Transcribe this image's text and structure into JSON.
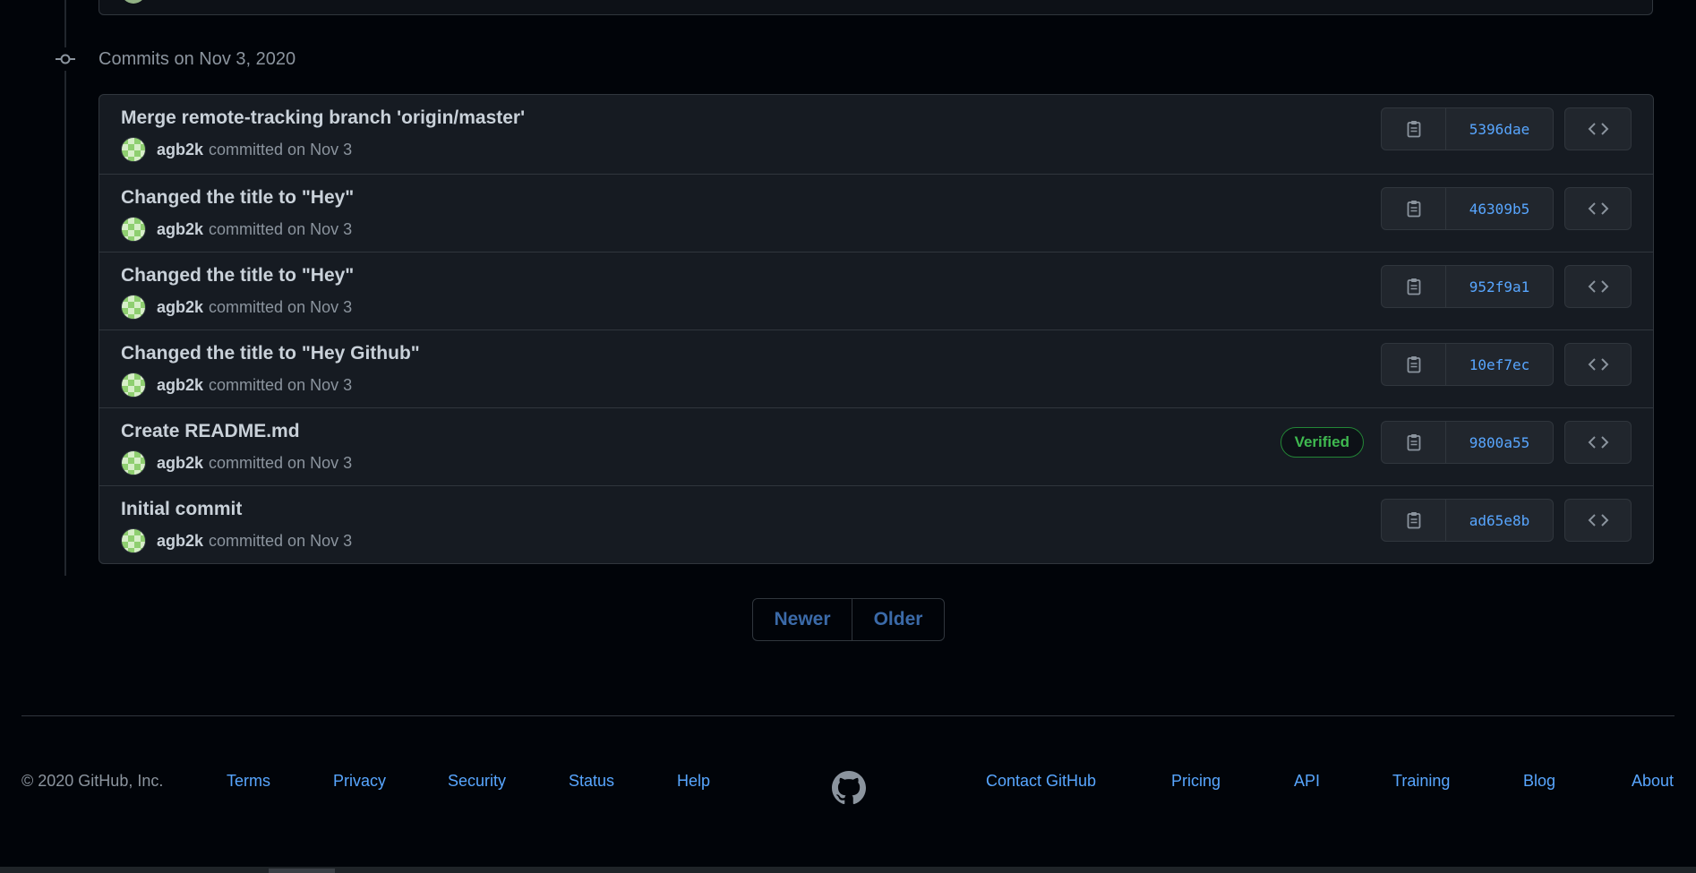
{
  "group": {
    "title": "Commits on Nov 3, 2020"
  },
  "commits": [
    {
      "title": "Merge remote-tracking branch 'origin/master'",
      "author": "agb2k",
      "meta": "committed on Nov 3",
      "sha": "5396dae",
      "verified": false
    },
    {
      "title": "Changed the title to \"Hey\"",
      "author": "agb2k",
      "meta": "committed on Nov 3",
      "sha": "46309b5",
      "verified": false
    },
    {
      "title": "Changed the title to \"Hey\"",
      "author": "agb2k",
      "meta": "committed on Nov 3",
      "sha": "952f9a1",
      "verified": false
    },
    {
      "title": "Changed the title to \"Hey Github\"",
      "author": "agb2k",
      "meta": "committed on Nov 3",
      "sha": "10ef7ec",
      "verified": false
    },
    {
      "title": "Create README.md",
      "author": "agb2k",
      "meta": "committed on Nov 3",
      "sha": "9800a55",
      "verified": true,
      "verified_label": "Verified"
    },
    {
      "title": "Initial commit",
      "author": "agb2k",
      "meta": "committed on Nov 3",
      "sha": "ad65e8b",
      "verified": false
    }
  ],
  "pagination": {
    "newer": "Newer",
    "older": "Older"
  },
  "footer": {
    "copyright": "© 2020 GitHub, Inc.",
    "left_links": [
      "Terms",
      "Privacy",
      "Security",
      "Status",
      "Help"
    ],
    "right_links": [
      "Contact GitHub",
      "Pricing",
      "API",
      "Training",
      "Blog",
      "About"
    ],
    "logo_icon": "github-mark-icon"
  },
  "colors": {
    "background": "#010409",
    "link": "#58a6ff",
    "verified": "#3fb950"
  }
}
